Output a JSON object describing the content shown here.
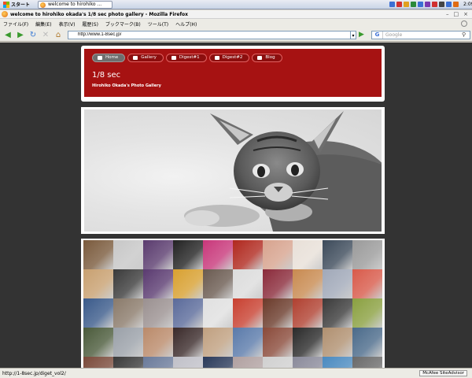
{
  "taskbar": {
    "start_label": "スタート",
    "task_label": "welcome to hirohiko ...",
    "clock": "2:09"
  },
  "window": {
    "title": "welcome to hirohiko okada's 1/8 sec photo gallery - Mozilla Firefox"
  },
  "menu": {
    "items": [
      "ファイル(F)",
      "編集(E)",
      "表示(V)",
      "履歴(S)",
      "ブックマーク(B)",
      "ツール(T)",
      "ヘルプ(H)"
    ]
  },
  "nav": {
    "url": "http://www.1-8sec.jp/",
    "search_placeholder": "Google"
  },
  "site": {
    "tabs": [
      "Home",
      "Gallery",
      "Digest#1",
      "Digest#2",
      "Blog"
    ],
    "active_tab": "Home",
    "title": "1/8 sec",
    "subtitle": "Hirohiko Okada's Photo Gallery"
  },
  "status": {
    "text": "http://1-8sec.jp/diget_vol2/",
    "addon": "McAfee SiteAdvisor"
  },
  "colors": {
    "header_red": "#a61212",
    "page_bg": "#333333",
    "grid_tiles": [
      "#7a5a3c",
      "#c7c7c7",
      "#5a3b6e",
      "#222222",
      "#c8377a",
      "#b0281e",
      "#d7a38e",
      "#e8e0d8",
      "#3c4a5a",
      "#9a9a9a",
      "#c8a070",
      "#3a3a3a",
      "#5a3a70",
      "#d8a030",
      "#6a5a50",
      "#dcdcdc",
      "#8a2a3a",
      "#c88a50",
      "#a0a8b8",
      "#d85a4a",
      "#3a5a8a",
      "#8a7a6a",
      "#9a9090",
      "#5a6a9a",
      "#e0e0e0",
      "#c84030",
      "#6a3a2a",
      "#b04030",
      "#3a3a3a",
      "#8aa040",
      "#4a5a3a",
      "#9aa0a8",
      "#ba8a6a",
      "#3a2a2a",
      "#c0a080",
      "#5a7aaa",
      "#8a4a3a",
      "#2a2a2a",
      "#b09070",
      "#4a6a8a",
      "#7a4a3a",
      "#3a3a3a",
      "#6a7a9a",
      "#c0c0c8",
      "#2a3a5a",
      "#b0a0a0",
      "#d0d0d0",
      "#8a8a9a",
      "#4a8ac0",
      "#6a6a6a"
    ]
  }
}
